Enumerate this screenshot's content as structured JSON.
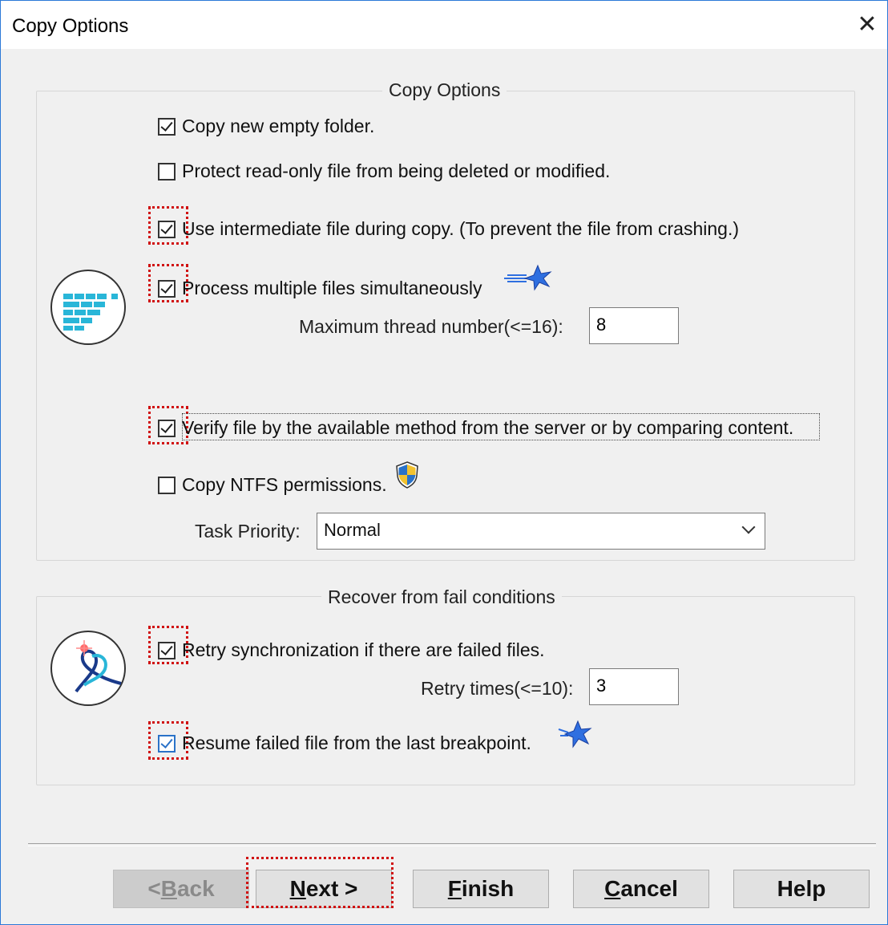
{
  "window": {
    "title": "Copy Options"
  },
  "copy_options": {
    "legend": "Copy Options",
    "copy_empty_folder": {
      "label": "Copy new empty folder.",
      "checked": true
    },
    "protect_readonly": {
      "label": "Protect read-only file from being deleted or modified.",
      "checked": false
    },
    "intermediate_file": {
      "label": "Use intermediate file during copy. (To prevent the file from crashing.)",
      "checked": true
    },
    "multi_files": {
      "label": "Process multiple files simultaneously",
      "checked": true
    },
    "max_thread": {
      "label": "Maximum thread number(<=16):",
      "value": "8"
    },
    "verify_file": {
      "label": "Verify file by the available method from the server or by comparing content.",
      "checked": true
    },
    "ntfs_permissions": {
      "label": "Copy NTFS permissions.",
      "checked": false
    },
    "task_priority": {
      "label": "Task Priority:",
      "selected": "Normal"
    }
  },
  "recover": {
    "legend": "Recover from fail conditions",
    "retry_sync": {
      "label": "Retry synchronization if there are failed files.",
      "checked": true
    },
    "retry_times": {
      "label": "Retry times(<=10):",
      "value": "3"
    },
    "resume_breakpoint": {
      "label": "Resume failed file from the last breakpoint.",
      "checked": true
    }
  },
  "buttons": {
    "back": {
      "prefix": "<",
      "accel": "B",
      "rest": "ack"
    },
    "next": {
      "accel": "N",
      "rest": "ext >"
    },
    "finish": {
      "accel": "F",
      "rest": "inish"
    },
    "cancel": {
      "accel": "C",
      "rest": "ancel"
    },
    "help": {
      "label": "Help"
    }
  },
  "colors": {
    "highlight": "#d01010",
    "window_border": "#2b79d8",
    "checkbox_blue": "#2a72c8",
    "icon_cyan": "#29b6d8",
    "star_blue": "#2f6fe0"
  }
}
